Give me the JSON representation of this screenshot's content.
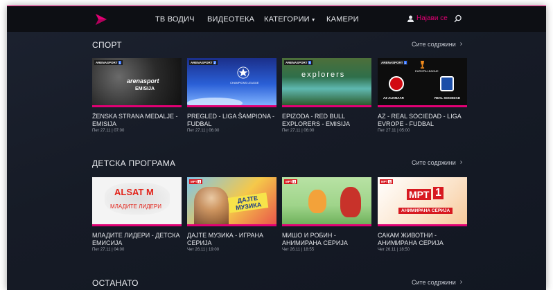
{
  "nav": {
    "items": [
      "ТВ ВОДИЧ",
      "ВИДЕОТЕКА",
      "КАТЕГОРИИ",
      "КАМЕРИ"
    ],
    "categories_caret": "▾",
    "login_label": "Најави се"
  },
  "sections": [
    {
      "title": "СПОРТ",
      "see_all": "Сите содржини",
      "cards": [
        {
          "title": "ŽENSKA STRANA MEDALJE - EMISIJA",
          "date": "Пет 27.11 | 07:00",
          "badge": "ARENASPORT",
          "badge_num": "1",
          "thumb_text": "arenasport",
          "thumb_sub": "EMISIJA"
        },
        {
          "title": "PREGLED - LIGA ŠAMPIONA - FUDBAL",
          "date": "Пет 27.11 | 06:00",
          "badge": "ARENASPORT",
          "badge_num": "2",
          "thumb_text": "CHAMPIONS LEAGUE"
        },
        {
          "title": "EPIZODA - RED BULL EXPLORERS - EMISIJA",
          "date": "Пет 27.11 | 06:00",
          "badge": "ARENASPORT",
          "badge_num": "5",
          "thumb_text": "explorers"
        },
        {
          "title": "AZ - REAL SOCIEDAD - LIGA EVROPE - FUDBAL",
          "date": "Пет 27.11 | 05:00",
          "badge": "ARENASPORT",
          "badge_num": "1",
          "thumb_text": "EUROPA LEAGUE",
          "thumb_left": "AZ ALKMAAR",
          "thumb_right": "REAL SOCIEDAD"
        }
      ]
    },
    {
      "title": "ДЕТСКА ПРОГРАМА",
      "see_all": "Сите содржини",
      "cards": [
        {
          "title": "МЛАДИТЕ ЛИДЕРИ - ДЕТСКА ЕМИСИЈА",
          "date": "Пет 27.11 | 04:00",
          "thumb_text": "ALSAT M",
          "thumb_sub": "МЛАДИТЕ ЛИДЕРИ"
        },
        {
          "title": "ДАЈТЕ МУЗИКА - ИГРАНА СЕРИЈА",
          "date": "Чет 26.11 | 19:00",
          "badge": "МРТ",
          "badge_num": "1",
          "thumb_text": "ДАЈТЕ МУЗИКА"
        },
        {
          "title": "МИШО И РОБИН - АНИМИРАНА СЕРИЈА",
          "date": "Чет 26.11 | 18:55",
          "badge": "МРТ",
          "badge_num": "1"
        },
        {
          "title": "САКАМ ЖИВОТНИ - АНИМИРАНА СЕРИЈА",
          "date": "Чет 26.11 | 18:50",
          "badge": "МРТ",
          "badge_num": "1",
          "thumb_text": "МРТ",
          "thumb_sub": "АНИМИРАНА СЕРИЈА"
        }
      ]
    },
    {
      "title": "ОСТАНАТО",
      "see_all": "Сите содржини",
      "cards": []
    }
  ],
  "colors": {
    "accent": "#e20074",
    "background": "#161b26",
    "topbar": "#0d0f14"
  },
  "icons": {
    "logo": "play-triangle-logo",
    "user": "user-icon",
    "search": "search-icon",
    "chevron": "chevron-right-icon"
  }
}
